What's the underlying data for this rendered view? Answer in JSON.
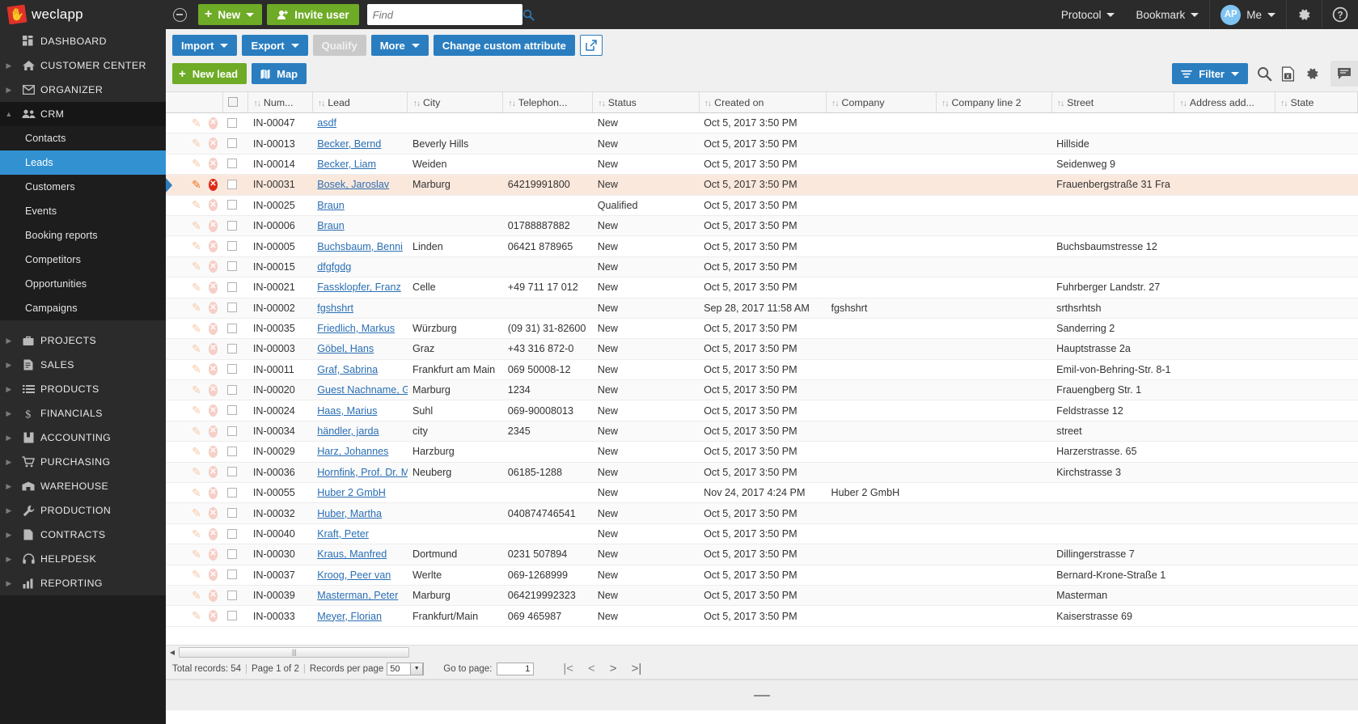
{
  "app": {
    "brand": "weclapp",
    "collapse_icon": "circle-minus-icon"
  },
  "topbar": {
    "new_label": "New",
    "invite_label": "Invite user",
    "search_placeholder": "Find",
    "search_value": "",
    "protocol_label": "Protocol",
    "bookmark_label": "Bookmark",
    "user_initials": "AP",
    "user_label": "Me",
    "settings_icon": "gear-icon",
    "help_icon": "question-mark-icon"
  },
  "sidebar": {
    "items": [
      {
        "label": "DASHBOARD",
        "icon": "dashboard-icon",
        "expandable": false,
        "active": false
      },
      {
        "label": "CUSTOMER CENTER",
        "icon": "home-icon",
        "expandable": true,
        "active": false
      },
      {
        "label": "ORGANIZER",
        "icon": "envelope-icon",
        "expandable": true,
        "active": false
      },
      {
        "label": "CRM",
        "icon": "people-icon",
        "expandable": true,
        "active": true
      }
    ],
    "crm_children": [
      {
        "label": "Contacts",
        "active": false
      },
      {
        "label": "Leads",
        "active": true
      },
      {
        "label": "Customers",
        "active": false
      },
      {
        "label": "Events",
        "active": false
      },
      {
        "label": "Booking reports",
        "active": false
      },
      {
        "label": "Competitors",
        "active": false
      },
      {
        "label": "Opportunities",
        "active": false
      },
      {
        "label": "Campaigns",
        "active": false
      }
    ],
    "lower_items": [
      {
        "label": "PROJECTS",
        "icon": "briefcase-icon"
      },
      {
        "label": "SALES",
        "icon": "document-icon"
      },
      {
        "label": "PRODUCTS",
        "icon": "list-icon"
      },
      {
        "label": "FINANCIALS",
        "icon": "dollar-icon"
      },
      {
        "label": "ACCOUNTING",
        "icon": "book-icon"
      },
      {
        "label": "PURCHASING",
        "icon": "cart-icon"
      },
      {
        "label": "WAREHOUSE",
        "icon": "warehouse-icon"
      },
      {
        "label": "PRODUCTION",
        "icon": "wrench-icon"
      },
      {
        "label": "CONTRACTS",
        "icon": "contract-icon"
      },
      {
        "label": "HELPDESK",
        "icon": "headset-icon"
      },
      {
        "label": "REPORTING",
        "icon": "bar-chart-icon"
      }
    ]
  },
  "toolbar": {
    "import_label": "Import",
    "export_label": "Export",
    "qualify_label": "Qualify",
    "more_label": "More",
    "change_attr_label": "Change custom attribute",
    "popout_icon": "external-link-icon",
    "new_lead_label": "New lead",
    "map_label": "Map",
    "filter_label": "Filter",
    "search_icon": "magnifier-icon",
    "excel_icon": "excel-export-icon",
    "settings_icon": "gear-icon",
    "notes_icon": "speech-bubble-icon"
  },
  "table": {
    "columns": [
      {
        "label": "Num...",
        "key": "num"
      },
      {
        "label": "Lead",
        "key": "lead"
      },
      {
        "label": "City",
        "key": "city"
      },
      {
        "label": "Telephon...",
        "key": "telephone"
      },
      {
        "label": "Status",
        "key": "status"
      },
      {
        "label": "Created on",
        "key": "created"
      },
      {
        "label": "Company",
        "key": "company"
      },
      {
        "label": "Company line 2",
        "key": "company2"
      },
      {
        "label": "Street",
        "key": "street"
      },
      {
        "label": "Address add...",
        "key": "address_add"
      },
      {
        "label": "State",
        "key": "state"
      }
    ],
    "rows": [
      {
        "num": "IN-00047",
        "lead": "asdf",
        "city": "",
        "telephone": "",
        "status": "New",
        "created": "Oct 5, 2017 3:50 PM",
        "company": "",
        "company2": "",
        "street": "",
        "address_add": "",
        "state": "",
        "selected": false
      },
      {
        "num": "IN-00013",
        "lead": "Becker, Bernd",
        "city": "Beverly Hills",
        "telephone": "",
        "status": "New",
        "created": "Oct 5, 2017 3:50 PM",
        "company": "",
        "company2": "",
        "street": "Hillside",
        "address_add": "",
        "state": "",
        "selected": false
      },
      {
        "num": "IN-00014",
        "lead": "Becker, Liam",
        "city": "Weiden",
        "telephone": "",
        "status": "New",
        "created": "Oct 5, 2017 3:50 PM",
        "company": "",
        "company2": "",
        "street": "Seidenweg 9",
        "address_add": "",
        "state": "",
        "selected": false
      },
      {
        "num": "IN-00031",
        "lead": "Bosek, Jaroslav",
        "city": "Marburg",
        "telephone": "64219991800",
        "status": "New",
        "created": "Oct 5, 2017 3:50 PM",
        "company": "",
        "company2": "",
        "street": "Frauenbergstraße 31 Fra",
        "address_add": "",
        "state": "",
        "selected": true
      },
      {
        "num": "IN-00025",
        "lead": "Braun",
        "city": "",
        "telephone": "",
        "status": "Qualified",
        "created": "Oct 5, 2017 3:50 PM",
        "company": "",
        "company2": "",
        "street": "",
        "address_add": "",
        "state": "",
        "selected": false
      },
      {
        "num": "IN-00006",
        "lead": "Braun",
        "city": "",
        "telephone": "01788887882",
        "status": "New",
        "created": "Oct 5, 2017 3:50 PM",
        "company": "",
        "company2": "",
        "street": "",
        "address_add": "",
        "state": "",
        "selected": false
      },
      {
        "num": "IN-00005",
        "lead": "Buchsbaum, Benni",
        "city": "Linden",
        "telephone": "06421 878965",
        "status": "New",
        "created": "Oct 5, 2017 3:50 PM",
        "company": "",
        "company2": "",
        "street": "Buchsbaumstresse 12",
        "address_add": "",
        "state": "",
        "selected": false
      },
      {
        "num": "IN-00015",
        "lead": "dfgfgdg",
        "city": "",
        "telephone": "",
        "status": "New",
        "created": "Oct 5, 2017 3:50 PM",
        "company": "",
        "company2": "",
        "street": "",
        "address_add": "",
        "state": "",
        "selected": false
      },
      {
        "num": "IN-00021",
        "lead": "Fassklopfer, Franz",
        "city": "Celle",
        "telephone": "+49 711 17 012",
        "status": "New",
        "created": "Oct 5, 2017 3:50 PM",
        "company": "",
        "company2": "",
        "street": "Fuhrberger Landstr. 27",
        "address_add": "",
        "state": "",
        "selected": false
      },
      {
        "num": "IN-00002",
        "lead": "fgshshrt",
        "city": "",
        "telephone": "",
        "status": "New",
        "created": "Sep 28, 2017 11:58 AM",
        "company": "fgshshrt",
        "company2": "",
        "street": "srthsrhtsh",
        "address_add": "",
        "state": "",
        "selected": false
      },
      {
        "num": "IN-00035",
        "lead": "Friedlich, Markus",
        "city": "Würzburg",
        "telephone": "(09 31) 31-82600",
        "status": "New",
        "created": "Oct 5, 2017 3:50 PM",
        "company": "",
        "company2": "",
        "street": "Sanderring 2",
        "address_add": "",
        "state": "",
        "selected": false
      },
      {
        "num": "IN-00003",
        "lead": "Göbel, Hans",
        "city": "Graz",
        "telephone": "+43 316 872-0",
        "status": "New",
        "created": "Oct 5, 2017 3:50 PM",
        "company": "",
        "company2": "",
        "street": "Hauptstrasse 2a",
        "address_add": "",
        "state": "",
        "selected": false
      },
      {
        "num": "IN-00011",
        "lead": "Graf, Sabrina",
        "city": "Frankfurt am Main",
        "telephone": "069 50008-12",
        "status": "New",
        "created": "Oct 5, 2017 3:50 PM",
        "company": "",
        "company2": "",
        "street": "Emil-von-Behring-Str. 8-1",
        "address_add": "",
        "state": "",
        "selected": false
      },
      {
        "num": "IN-00020",
        "lead": "Guest Nachname, Gu",
        "city": "Marburg",
        "telephone": "1234",
        "status": "New",
        "created": "Oct 5, 2017 3:50 PM",
        "company": "",
        "company2": "",
        "street": "Frauengberg Str. 1",
        "address_add": "",
        "state": "",
        "selected": false
      },
      {
        "num": "IN-00024",
        "lead": "Haas, Marius",
        "city": "Suhl",
        "telephone": "069-90008013",
        "status": "New",
        "created": "Oct 5, 2017 3:50 PM",
        "company": "",
        "company2": "",
        "street": "Feldstrasse 12",
        "address_add": "",
        "state": "",
        "selected": false
      },
      {
        "num": "IN-00034",
        "lead": "händler, jarda",
        "city": "city",
        "telephone": "2345",
        "status": "New",
        "created": "Oct 5, 2017 3:50 PM",
        "company": "",
        "company2": "",
        "street": "street",
        "address_add": "",
        "state": "",
        "selected": false
      },
      {
        "num": "IN-00029",
        "lead": "Harz, Johannes",
        "city": "Harzburg",
        "telephone": "",
        "status": "New",
        "created": "Oct 5, 2017 3:50 PM",
        "company": "",
        "company2": "",
        "street": "Harzerstrasse. 65",
        "address_add": "",
        "state": "",
        "selected": false
      },
      {
        "num": "IN-00036",
        "lead": "Hornfink, Prof. Dr. Max",
        "city": "Neuberg",
        "telephone": "06185-1288",
        "status": "New",
        "created": "Oct 5, 2017 3:50 PM",
        "company": "",
        "company2": "",
        "street": "Kirchstrasse 3",
        "address_add": "",
        "state": "",
        "selected": false
      },
      {
        "num": "IN-00055",
        "lead": "Huber 2 GmbH",
        "city": "",
        "telephone": "",
        "status": "New",
        "created": "Nov 24, 2017 4:24 PM",
        "company": "Huber 2 GmbH",
        "company2": "",
        "street": "",
        "address_add": "",
        "state": "",
        "selected": false
      },
      {
        "num": "IN-00032",
        "lead": "Huber, Martha",
        "city": "",
        "telephone": "040874746541",
        "status": "New",
        "created": "Oct 5, 2017 3:50 PM",
        "company": "",
        "company2": "",
        "street": "",
        "address_add": "",
        "state": "",
        "selected": false
      },
      {
        "num": "IN-00040",
        "lead": "Kraft, Peter",
        "city": "",
        "telephone": "",
        "status": "New",
        "created": "Oct 5, 2017 3:50 PM",
        "company": "",
        "company2": "",
        "street": "",
        "address_add": "",
        "state": "",
        "selected": false
      },
      {
        "num": "IN-00030",
        "lead": "Kraus, Manfred",
        "city": "Dortmund",
        "telephone": "0231 507894",
        "status": "New",
        "created": "Oct 5, 2017 3:50 PM",
        "company": "",
        "company2": "",
        "street": "Dillingerstrasse 7",
        "address_add": "",
        "state": "",
        "selected": false
      },
      {
        "num": "IN-00037",
        "lead": "Kroog, Peer van",
        "city": "Werlte",
        "telephone": "069-1268999",
        "status": "New",
        "created": "Oct 5, 2017 3:50 PM",
        "company": "",
        "company2": "",
        "street": "Bernard-Krone-Straße 1",
        "address_add": "",
        "state": "",
        "selected": false
      },
      {
        "num": "IN-00039",
        "lead": "Masterman, Peter",
        "city": "Marburg",
        "telephone": "064219992323",
        "status": "New",
        "created": "Oct 5, 2017 3:50 PM",
        "company": "",
        "company2": "",
        "street": "Masterman",
        "address_add": "",
        "state": "",
        "selected": false
      },
      {
        "num": "IN-00033",
        "lead": "Meyer, Florian",
        "city": "Frankfurt/Main",
        "telephone": "069 465987",
        "status": "New",
        "created": "Oct 5, 2017 3:50 PM",
        "company": "",
        "company2": "",
        "street": "Kaiserstrasse 69",
        "address_add": "",
        "state": "",
        "selected": false
      }
    ]
  },
  "pager": {
    "total_label": "Total records: 54",
    "page_label": "Page 1 of 2",
    "rpp_label": "Records per page",
    "rpp_value": "50",
    "goto_label": "Go to page:",
    "goto_value": "1",
    "first_icon": "first-page-icon",
    "prev_icon": "prev-page-icon",
    "next_icon": "next-page-icon",
    "last_icon": "last-page-icon"
  },
  "colors": {
    "accent_blue": "#2a7ec0",
    "accent_green": "#6eab26",
    "sidebar_bg": "#1d1d1d",
    "selected_row": "#fbe8dd",
    "link": "#2a6fb5"
  }
}
